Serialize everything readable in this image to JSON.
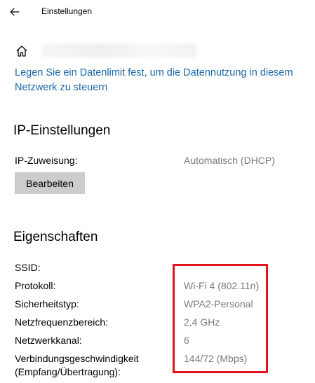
{
  "window": {
    "title": "Einstellungen"
  },
  "icons": {
    "back": "arrow-left-icon",
    "home": "home-icon"
  },
  "colors": {
    "link": "#1967a9",
    "value_text": "#7a7a7a",
    "button_bg": "#cccccc",
    "highlight_border": "#e0121c"
  },
  "data_limit_link": "Legen Sie ein Datenlimit fest, um die Datennutzung in diesem Netzwerk zu steuern",
  "ip_settings": {
    "heading": "IP-Einstellungen",
    "assignment_label": "IP-Zuweisung:",
    "assignment_value": "Automatisch (DHCP)",
    "edit_button": "Bearbeiten"
  },
  "properties": {
    "heading": "Eigenschaften",
    "rows": [
      {
        "label": "SSID:",
        "value": ""
      },
      {
        "label": "Protokoll:",
        "value": "Wi-Fi 4 (802.11n)"
      },
      {
        "label": "Sicherheitstyp:",
        "value": "WPA2-Personal"
      },
      {
        "label": "Netzfrequenzbereich:",
        "value": "2,4 GHz"
      },
      {
        "label": "Netzwerkkanal:",
        "value": "6"
      },
      {
        "label": "Verbindungsgeschwindigkeit",
        "label_line2": "(Empfang/Übertragung):",
        "value": "144/72 (Mbps)"
      }
    ]
  }
}
